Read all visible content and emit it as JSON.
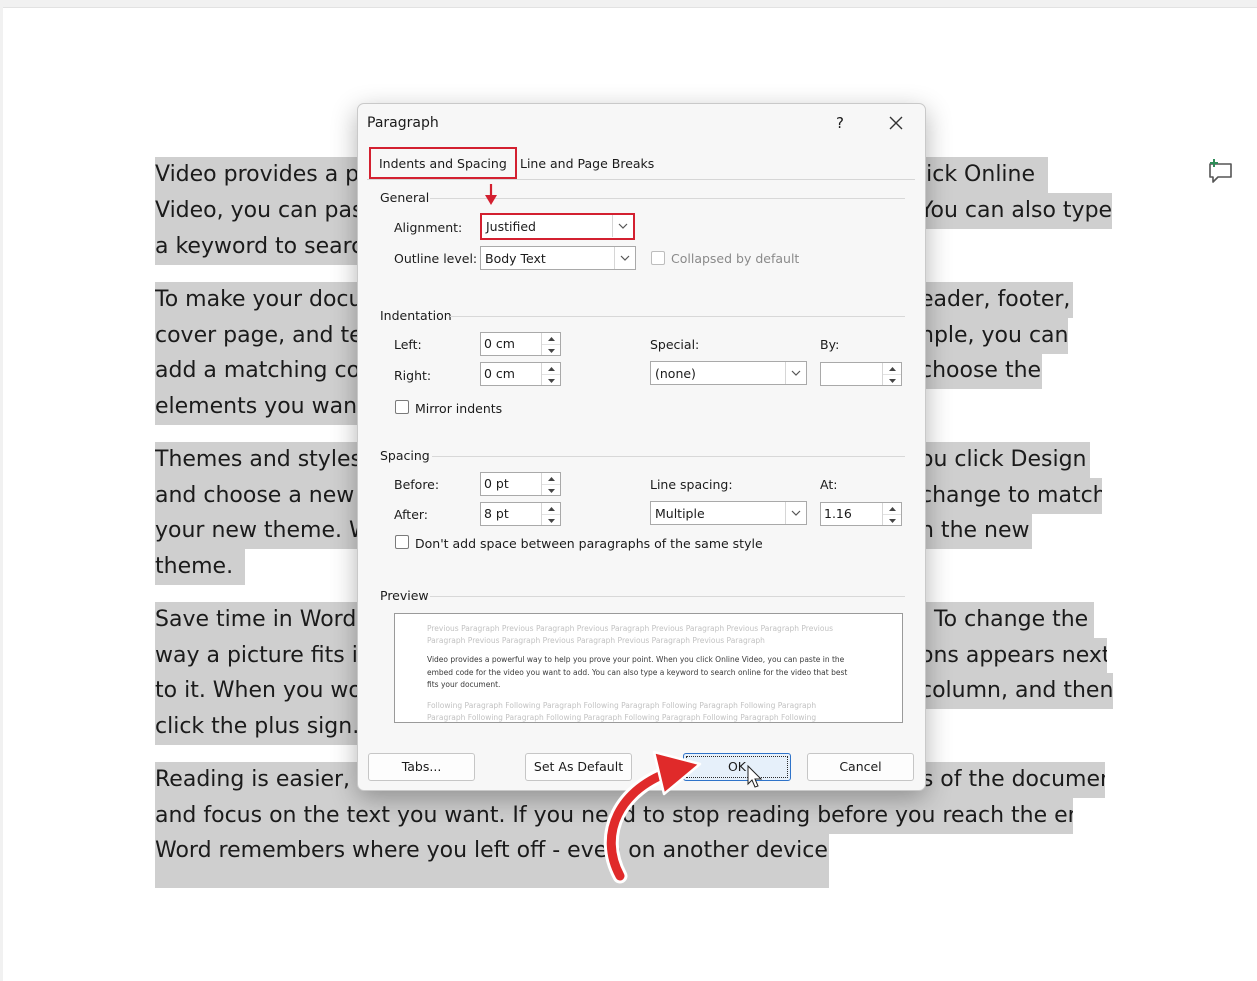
{
  "document": {
    "lines": [
      {
        "id": "p1-l1-left",
        "text": "Video provides a po"
      },
      {
        "id": "p1-l1-right",
        "text": "lick Online"
      },
      {
        "id": "p1-l2-left",
        "text": "Video, you can pas"
      },
      {
        "id": "p1-l2-right",
        "text": "You can also type"
      },
      {
        "id": "p1-l3-left",
        "text": "a keyword to searc"
      },
      {
        "id": "p2-l1-left",
        "text": "To make your docu"
      },
      {
        "id": "p2-l1-right",
        "text": "eader, footer,"
      },
      {
        "id": "p2-l2-left",
        "text": "cover page, and tex"
      },
      {
        "id": "p2-l2-right",
        "text": "nple, you can"
      },
      {
        "id": "p2-l3-left",
        "text": "add a matching co"
      },
      {
        "id": "p2-l3-right",
        "text": "choose the"
      },
      {
        "id": "p2-l4-left",
        "text": "elements you want"
      },
      {
        "id": "p3-l1-left",
        "text": "Themes and styles"
      },
      {
        "id": "p3-l1-right",
        "text": "ou click Design"
      },
      {
        "id": "p3-l2-left",
        "text": "and choose a new T"
      },
      {
        "id": "p3-l2-right",
        "text": "change to match"
      },
      {
        "id": "p3-l3-left",
        "text": "your new theme. W"
      },
      {
        "id": "p3-l3-right",
        "text": "n the new"
      },
      {
        "id": "p3-l4-left",
        "text": "theme."
      },
      {
        "id": "p4-l1-left",
        "text": "Save time in Word w"
      },
      {
        "id": "p4-l1-right",
        "text": ". To change the"
      },
      {
        "id": "p4-l2-left",
        "text": "way a picture fits in"
      },
      {
        "id": "p4-l2-right",
        "text": "ons appears next"
      },
      {
        "id": "p4-l3-left",
        "text": "to it. When you wor"
      },
      {
        "id": "p4-l3-right",
        "text": "column, and then"
      },
      {
        "id": "p4-l4-left",
        "text": "click the plus sign."
      },
      {
        "id": "p5-l1",
        "text": "Reading is easier, too, in the new Reading view. You can collapse parts of the document"
      },
      {
        "id": "p5-l2",
        "text": "and focus on the text you want. If you need to stop reading before you reach the end,"
      },
      {
        "id": "p5-l3",
        "text": "Word remembers where you left off - even on another device."
      }
    ]
  },
  "dialog": {
    "title": "Paragraph",
    "help": "?",
    "tabs": [
      "Indents and Spacing",
      "Line and Page Breaks"
    ],
    "general": {
      "heading": "General",
      "alignment_label": "Alignment:",
      "alignment_value": "Justified",
      "outline_label": "Outline level:",
      "outline_value": "Body Text",
      "collapsed_label": "Collapsed by default"
    },
    "indentation": {
      "heading": "Indentation",
      "left_label": "Left:",
      "left_value": "0 cm",
      "right_label": "Right:",
      "right_value": "0 cm",
      "special_label": "Special:",
      "special_value": "(none)",
      "by_label": "By:",
      "by_value": "",
      "mirror_label": "Mirror indents"
    },
    "spacing": {
      "heading": "Spacing",
      "before_label": "Before:",
      "before_value": "0 pt",
      "after_label": "After:",
      "after_value": "8 pt",
      "line_spacing_label": "Line spacing:",
      "line_spacing_value": "Multiple",
      "at_label": "At:",
      "at_value": "1.16",
      "dont_add_label": "Don't add space between paragraphs of the same style"
    },
    "preview": {
      "heading": "Preview",
      "previous_lines": [
        "Previous Paragraph Previous Paragraph Previous Paragraph Previous Paragraph Previous Paragraph Previous",
        "Paragraph Previous Paragraph Previous Paragraph Previous Paragraph Previous Paragraph"
      ],
      "sample": "Video provides a powerful way to help you prove your point. When you click Online Video, you can paste in the embed code for the video you want to add. You can also type a keyword to search online for the video that best fits your document.",
      "following_lines": [
        "Following Paragraph Following Paragraph Following Paragraph Following Paragraph Following Paragraph",
        "Paragraph Following Paragraph Following Paragraph Following Paragraph Following Paragraph Following"
      ]
    },
    "buttons": {
      "tabs": "Tabs...",
      "set_default": "Set As Default",
      "ok": "OK",
      "cancel": "Cancel"
    }
  },
  "colors": {
    "highlight_box": "#d32030",
    "selection": "#cfcfcf",
    "ok_border": "#2f73c9"
  }
}
